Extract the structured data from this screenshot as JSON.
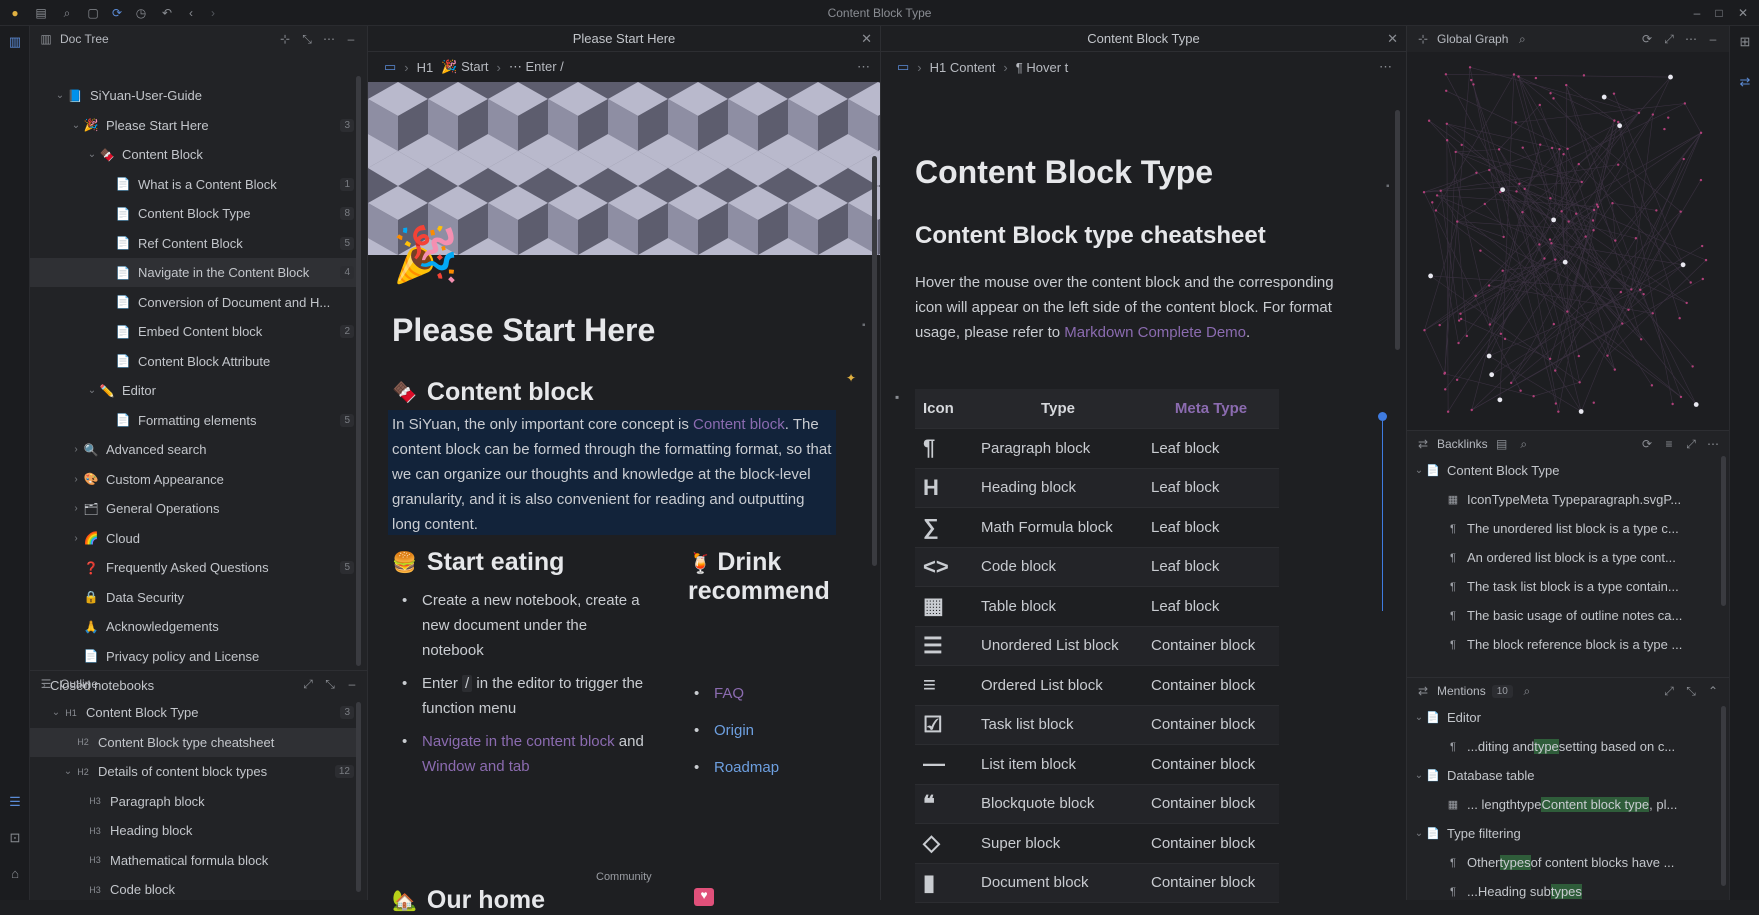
{
  "window": {
    "title": "Content Block Type"
  },
  "doctree": {
    "title": "Doc Tree",
    "items": [
      {
        "label": "SiYuan-User-Guide",
        "icon": "📘",
        "count": ""
      },
      {
        "label": "Please Start Here",
        "icon": "🎉",
        "count": "3"
      },
      {
        "label": "Content Block",
        "icon": "🍫",
        "count": ""
      },
      {
        "label": "What is a Content Block",
        "icon": "📄",
        "count": "1"
      },
      {
        "label": "Content Block Type",
        "icon": "📄",
        "count": "8"
      },
      {
        "label": "Ref Content Block",
        "icon": "📄",
        "count": "5"
      },
      {
        "label": "Navigate in the Content Block",
        "icon": "📄",
        "count": "4"
      },
      {
        "label": "Conversion of Document and H...",
        "icon": "📄",
        "count": ""
      },
      {
        "label": "Embed Content block",
        "icon": "📄",
        "count": "2"
      },
      {
        "label": "Content Block Attribute",
        "icon": "📄",
        "count": ""
      },
      {
        "label": "Editor",
        "icon": "✏️",
        "count": ""
      },
      {
        "label": "Formatting elements",
        "icon": "📄",
        "count": "5"
      },
      {
        "label": "Advanced search",
        "icon": "🔍",
        "count": ""
      },
      {
        "label": "Custom Appearance",
        "icon": "🎨",
        "count": ""
      },
      {
        "label": "General Operations",
        "icon": "🗂",
        "count": ""
      },
      {
        "label": "Cloud",
        "icon": "🌈",
        "count": ""
      },
      {
        "label": "Frequently Asked Questions",
        "icon": "❓",
        "count": "5"
      },
      {
        "label": "Data Security",
        "icon": "🔒",
        "count": ""
      },
      {
        "label": "Acknowledgements",
        "icon": "🙏",
        "count": ""
      },
      {
        "label": "Privacy policy and License",
        "icon": "📄",
        "count": ""
      },
      {
        "label": "Closed notebooks",
        "icon": "",
        "count": ""
      }
    ]
  },
  "outline": {
    "title": "Outline",
    "items": [
      {
        "label": "Content Block Type",
        "icon": "H1",
        "count": "3"
      },
      {
        "label": "Content Block type cheatsheet",
        "icon": "H2",
        "count": ""
      },
      {
        "label": "Details of content block types",
        "icon": "H2",
        "count": "12"
      },
      {
        "label": "Paragraph block",
        "icon": "H3",
        "count": ""
      },
      {
        "label": "Heading block",
        "icon": "H3",
        "count": ""
      },
      {
        "label": "Mathematical formula block",
        "icon": "H3",
        "count": ""
      },
      {
        "label": "Code block",
        "icon": "H3",
        "count": ""
      }
    ]
  },
  "editor1": {
    "tab": "Please Start Here",
    "crumbs": [
      "H1",
      "🎉 Start",
      "⋯ Enter /"
    ],
    "title": "Please Start Here",
    "h_content": "Content block",
    "intro_a": "In SiYuan, the only important core concept is ",
    "intro_link": "Content block",
    "intro_b": ". The content block can be formed through the formatting format, so that we can organize our thoughts and knowledge at the block-level granularity, and it is also convenient for reading and outputting long content.",
    "h_eat": "Start eating",
    "eat1": "Create a new notebook, create a new document under the notebook",
    "eat2a": "Enter ",
    "eat2b": " in the editor to trigger the function menu",
    "eat3a": "Navigate in the content block",
    "eat3b": " and ",
    "eat3c": "Window and tab",
    "h_drink": "Drink recommend",
    "drink": [
      "FAQ",
      "Origin",
      "Roadmap"
    ],
    "h_home": "Our home",
    "community": "Community"
  },
  "editor2": {
    "tab": "Content Block Type",
    "crumbs": [
      "H1 Content",
      "¶ Hover t"
    ],
    "title": "Content Block Type",
    "subtitle": "Content Block type cheatsheet",
    "desc_a": "Hover the mouse over the content block and the corresponding icon will appear on the left side of the content block. For format usage, please refer to ",
    "desc_link": "Markdown Complete Demo",
    "desc_b": ".",
    "table": {
      "headers": [
        "Icon",
        "Type",
        "Meta Type"
      ],
      "rows": [
        {
          "icon": "¶",
          "type": "Paragraph block",
          "meta": "Leaf block"
        },
        {
          "icon": "H",
          "type": "Heading block",
          "meta": "Leaf block"
        },
        {
          "icon": "∑",
          "type": "Math Formula block",
          "meta": "Leaf block"
        },
        {
          "icon": "<>",
          "type": "Code block",
          "meta": "Leaf block"
        },
        {
          "icon": "▦",
          "type": "Table block",
          "meta": "Leaf block"
        },
        {
          "icon": "☰",
          "type": "Unordered List block",
          "meta": "Container block"
        },
        {
          "icon": "≡",
          "type": "Ordered List block",
          "meta": "Container block"
        },
        {
          "icon": "☑",
          "type": "Task list block",
          "meta": "Container block"
        },
        {
          "icon": "—",
          "type": "List item block",
          "meta": "Container block"
        },
        {
          "icon": "❝",
          "type": "Blockquote block",
          "meta": "Container block"
        },
        {
          "icon": "◇",
          "type": "Super block",
          "meta": "Container block"
        },
        {
          "icon": "▮",
          "type": "Document block",
          "meta": "Container block"
        }
      ]
    }
  },
  "graph": {
    "title": "Global Graph"
  },
  "backlinks": {
    "title": "Backlinks",
    "items": [
      {
        "label": "Content Block Type",
        "icon": "📄",
        "level": 0
      },
      {
        "label": "IconTypeMeta Typeparagraph.svgP...",
        "icon": "▦",
        "level": 1
      },
      {
        "label": "The unordered list block is a type c...",
        "icon": "¶",
        "level": 1
      },
      {
        "label": "An ordered list block is a type cont...",
        "icon": "¶",
        "level": 1
      },
      {
        "label": "The task list block is a type contain...",
        "icon": "¶",
        "level": 1
      },
      {
        "label": "The basic usage of outline notes ca...",
        "icon": "¶",
        "level": 1
      },
      {
        "label": "The block reference block is a type ...",
        "icon": "¶",
        "level": 1
      }
    ]
  },
  "mentions": {
    "title": "Mentions",
    "count": "10",
    "items": [
      {
        "label": "Editor",
        "icon": "📄",
        "level": 0,
        "pre": "",
        "hl": "",
        "post": ""
      },
      {
        "label": "",
        "icon": "¶",
        "level": 1,
        "pre": "...diting and ",
        "hl": "type",
        "post": "setting based on c..."
      },
      {
        "label": "Database table",
        "icon": "📄",
        "level": 0,
        "pre": "",
        "hl": "",
        "post": ""
      },
      {
        "label": "",
        "icon": "▦",
        "level": 1,
        "pre": "... lengthtype",
        "hl": "Content block type",
        "post": ", pl..."
      },
      {
        "label": "Type filtering",
        "icon": "📄",
        "level": 0,
        "pre": "",
        "hl": "",
        "post": ""
      },
      {
        "label": "",
        "icon": "¶",
        "level": 1,
        "pre": "Other ",
        "hl": "types",
        "post": " of content blocks have ..."
      },
      {
        "label": "",
        "icon": "¶",
        "level": 1,
        "pre": "...Heading sub",
        "hl": "types",
        "post": ""
      }
    ]
  }
}
